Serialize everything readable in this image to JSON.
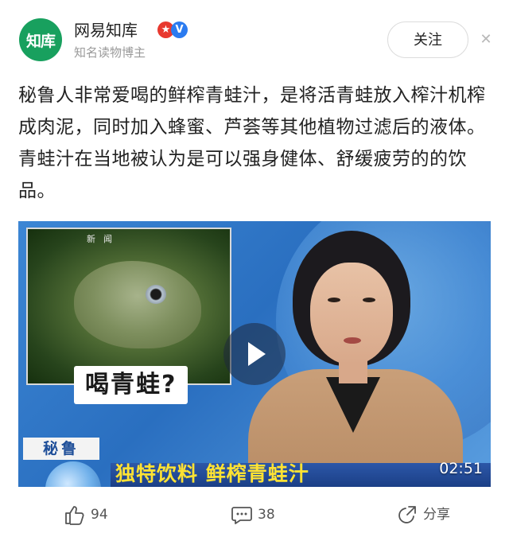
{
  "author": {
    "avatar_text": "知库",
    "name": "网易知库",
    "subtitle": "知名读物博主",
    "badge_red_glyph": "★",
    "badge_blue_glyph": "V"
  },
  "follow_label": "关注",
  "close_glyph": "✕",
  "post": {
    "text": "秘鲁人非常爱喝的鲜榨青蛙汁，是将活青蛙放入榨汁机榨成肉泥，同时加入蜂蜜、芦荟等其他植物过滤后的液体。青蛙汁在当地被认为是可以强身健体、舒缓疲劳的的饮品。"
  },
  "video": {
    "inset_label": "新闻",
    "inset_caption": "喝青蛙?",
    "location_label": "秘鲁",
    "headline": "独特饮料 鲜榨青蛙汁",
    "duration": "02:51"
  },
  "actions": {
    "like_count": "94",
    "comment_count": "38",
    "share_label": "分享"
  },
  "colors": {
    "brand_green": "#18a05e",
    "badge_red": "#e8392f",
    "badge_blue": "#2b7bf0",
    "headline_yellow": "#ffe233"
  }
}
